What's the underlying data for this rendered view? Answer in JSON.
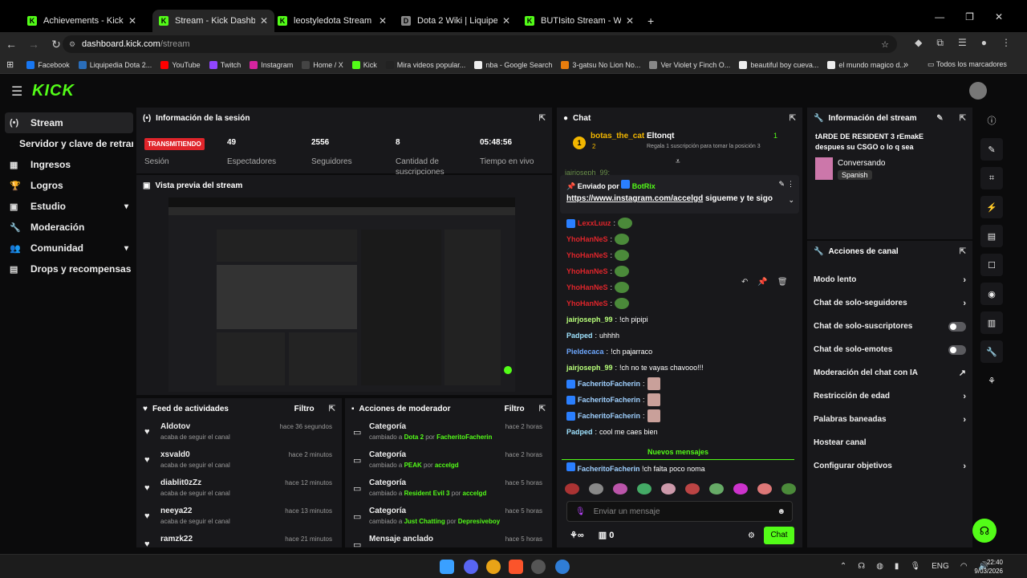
{
  "browser": {
    "tabs": [
      {
        "title": "Achievements - Kick Dashboard",
        "color": "#53fc18",
        "glyph": "K",
        "active": false
      },
      {
        "title": "Stream - Kick Dashboard",
        "color": "#53fc18",
        "glyph": "K",
        "active": true
      },
      {
        "title": "leostyledota Stream - Watch Li",
        "color": "#53fc18",
        "glyph": "K",
        "active": false
      },
      {
        "title": "Dota 2 Wiki | Liquipedia",
        "color": "#888888",
        "glyph": "D",
        "active": false
      },
      {
        "title": "BUTIsito Stream - Watch Li",
        "color": "#53fc18",
        "glyph": "K",
        "active": false
      }
    ],
    "new_tab": "+",
    "window_controls": [
      "—",
      "❐",
      "✕"
    ],
    "url_host": "dashboard.kick.com",
    "url_path": "/stream",
    "bookmarks": [
      {
        "label": "Facebook",
        "color": "#1877f2"
      },
      {
        "label": "Liquipedia Dota 2...",
        "color": "#2a6ebb"
      },
      {
        "label": "YouTube",
        "color": "#ff0000"
      },
      {
        "label": "Twitch",
        "color": "#9146ff"
      },
      {
        "label": "Instagram",
        "color": "#d6249f"
      },
      {
        "label": "Home / X",
        "color": "#444444"
      },
      {
        "label": "Kick",
        "color": "#53fc18"
      },
      {
        "label": "Mira videos popular...",
        "color": "#222222"
      },
      {
        "label": "nba - Google Search",
        "color": "#eeeeee"
      },
      {
        "label": "3-gatsu No Lion No...",
        "color": "#e87d0d"
      },
      {
        "label": "Ver Violet y Finch O...",
        "color": "#888888"
      },
      {
        "label": "beautiful boy cueva...",
        "color": "#eeeeee"
      },
      {
        "label": "el mundo magico d...",
        "color": "#eeeeee"
      }
    ],
    "all_bookmarks": "Todos los marcadores"
  },
  "sidebar": {
    "items": [
      {
        "label": "Stream",
        "icon": "(•)",
        "active": true
      },
      {
        "label": "Servidor y clave de retransm",
        "icon": "",
        "active": false
      },
      {
        "label": "Ingresos",
        "icon": "▦",
        "active": false
      },
      {
        "label": "Logros",
        "icon": "🏆",
        "active": false
      },
      {
        "label": "Estudio",
        "icon": "▣",
        "active": false,
        "chev": "▾"
      },
      {
        "label": "Moderación",
        "icon": "🔧",
        "active": false
      },
      {
        "label": "Comunidad",
        "icon": "👥",
        "active": false,
        "chev": "▾"
      },
      {
        "label": "Drops y recompensas",
        "icon": "▤",
        "active": false
      }
    ]
  },
  "session": {
    "title": "Información de la sesión",
    "status": "TRANSMITIENDO",
    "status_label": "Sesión",
    "stats": [
      {
        "value": "49",
        "label": "Espectadores"
      },
      {
        "value": "2556",
        "label": "Seguidores"
      },
      {
        "value": "8",
        "label": "Cantidad de suscripciones"
      },
      {
        "value": "05:48:56",
        "label": "Tiempo en vivo"
      }
    ]
  },
  "preview": {
    "title": "Vista previa del stream"
  },
  "feed": {
    "title": "Feed de actividades",
    "filter": "Filtro",
    "items": [
      {
        "name": "Aldotov",
        "sub": "acaba de seguir el canal",
        "time": "hace 36 segundos"
      },
      {
        "name": "xsvald0",
        "sub": "acaba de seguir el canal",
        "time": "hace 2 minutos"
      },
      {
        "name": "diablit0zZz",
        "sub": "acaba de seguir el canal",
        "time": "hace 12 minutos"
      },
      {
        "name": "neeya22",
        "sub": "acaba de seguir el canal",
        "time": "hace 13 minutos"
      },
      {
        "name": "ramzk22",
        "sub": "",
        "time": "hace 21 minutos"
      }
    ]
  },
  "mod": {
    "title": "Acciones de moderador",
    "filter": "Filtro",
    "items": [
      {
        "name": "Categoría",
        "pre": "cambiado a ",
        "cat": "Dota 2",
        "by": " por ",
        "user": "FacheritoFacherin",
        "time": "hace 2 horas"
      },
      {
        "name": "Categoría",
        "pre": "cambiado a ",
        "cat": "PEAK",
        "by": " por ",
        "user": "accelgd",
        "time": "hace 2 horas"
      },
      {
        "name": "Categoría",
        "pre": "cambiado a ",
        "cat": "Resident Evil 3",
        "by": " por ",
        "user": "accelgd",
        "time": "hace 5 horas"
      },
      {
        "name": "Categoría",
        "pre": "cambiado a ",
        "cat": "Just Chatting",
        "by": " por ",
        "user": "Depresiveboy",
        "time": "hace 5 horas"
      },
      {
        "name": "Mensaje anclado",
        "pre": "",
        "cat": "",
        "by": "",
        "user": "",
        "time": "hace 5 horas"
      }
    ]
  },
  "chat": {
    "title": "Chat",
    "top_user": "botas_the_cat",
    "top_rank": "1",
    "top_count": "2",
    "gift_user": "Eltonqt",
    "gift_text": "Regala 1 suscripción para tomar la posición 3",
    "gift_count": "1",
    "cut_user": "jairjoseph_99:",
    "pinned_label": "Enviado por",
    "pinned_by": "BotRix",
    "pinned_link": "https://www.instagram.com/accelgd",
    "pinned_text": " sigueme y te sigo",
    "lines": [
      {
        "user": "LexxLuuz",
        "color": "#e0252b",
        "text": "",
        "emote": true,
        "badge": true
      },
      {
        "user": "YhoHanNeS",
        "color": "#e0252b",
        "text": "",
        "emote": true,
        "badge": false
      },
      {
        "user": "YhoHanNeS",
        "color": "#e0252b",
        "text": "",
        "emote": true,
        "badge": false
      },
      {
        "user": "YhoHanNeS",
        "color": "#e0252b",
        "text": "",
        "emote": true,
        "badge": false
      },
      {
        "user": "YhoHanNeS",
        "color": "#e0252b",
        "text": "",
        "emote": true,
        "badge": false
      },
      {
        "user": "YhoHanNeS",
        "color": "#e0252b",
        "text": "",
        "emote": true,
        "badge": false
      },
      {
        "user": "jairjoseph_99",
        "color": "#b8ff7a",
        "text": " !ch pipipi",
        "emote": false,
        "badge": false
      },
      {
        "user": "Padped",
        "color": "#9fe3ff",
        "text": " uhhhh",
        "emote": false,
        "badge": false
      },
      {
        "user": "Pieldecaca",
        "color": "#6ea8ff",
        "text": " !ch pajarraco",
        "emote": false,
        "badge": false
      },
      {
        "user": "jairjoseph_99",
        "color": "#b8ff7a",
        "text": " !ch no te vayas chavooo!!!",
        "emote": false,
        "badge": false
      },
      {
        "user": "FacheritoFacherin",
        "color": "#9fd0ff",
        "text": "",
        "emote": true,
        "badge": true
      },
      {
        "user": "FacheritoFacherin",
        "color": "#9fd0ff",
        "text": "",
        "emote": true,
        "badge": true
      },
      {
        "user": "FacheritoFacherin",
        "color": "#9fd0ff",
        "text": "",
        "emote": true,
        "badge": true
      },
      {
        "user": "Padped",
        "color": "#9fe3ff",
        "text": " cool me caes bien",
        "emote": false,
        "badge": false
      }
    ],
    "new_messages": "Nuevos mensajes",
    "last_user": "FacheritoFacherin",
    "last_text": " !ch falta poco noma",
    "input_placeholder": "Enviar un mensaje",
    "infinity": "∞",
    "count": "0",
    "send": "Chat"
  },
  "streaminfo": {
    "title": "Información del stream",
    "name": "tARDE DE RESIDENT 3 rEmakE",
    "name2": "despues su CSGO o lo q sea",
    "category": "Conversando",
    "language": "Spanish"
  },
  "channel": {
    "title": "Acciones de canal",
    "items": [
      {
        "label": "Modo lento",
        "kind": "arrow"
      },
      {
        "label": "Chat de solo-seguidores",
        "kind": "arrow"
      },
      {
        "label": "Chat de solo-suscriptores",
        "kind": "toggle"
      },
      {
        "label": "Chat de solo-emotes",
        "kind": "toggle"
      },
      {
        "label": "Moderación del chat con IA",
        "kind": "ext"
      },
      {
        "label": "Restricción de edad",
        "kind": "arrow"
      },
      {
        "label": "Palabras baneadas",
        "kind": "arrow"
      },
      {
        "label": "Hostear canal",
        "kind": "none"
      },
      {
        "label": "Configurar objetivos",
        "kind": "arrow"
      }
    ]
  },
  "taskbar": {
    "lang": "ENG",
    "time": "22:40",
    "date": "9/03/2026"
  }
}
